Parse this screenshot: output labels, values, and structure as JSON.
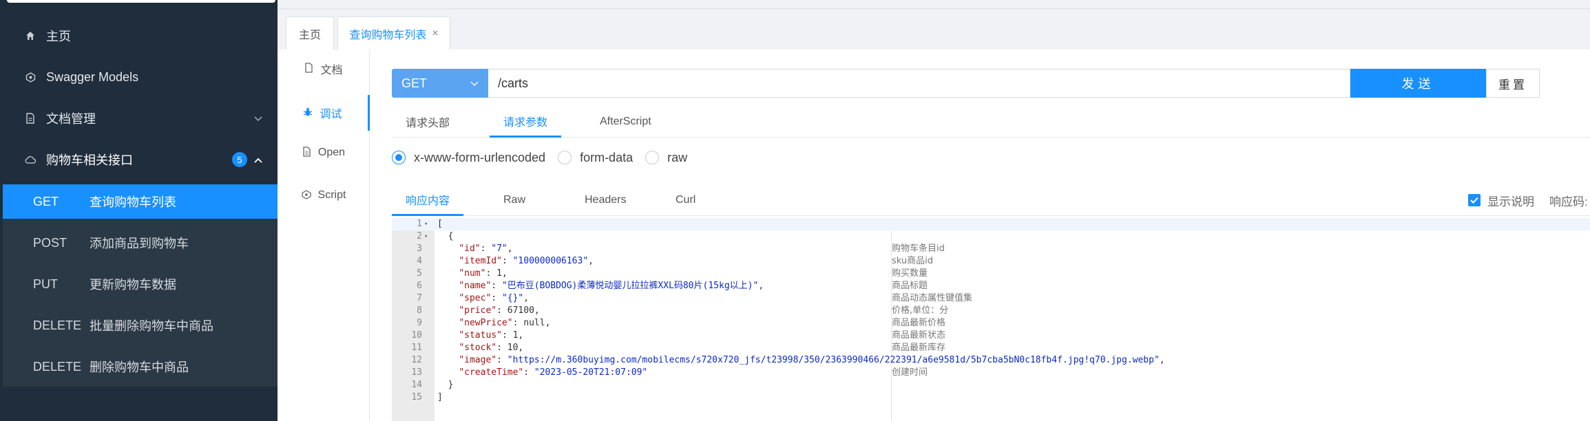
{
  "sidebar": {
    "items": [
      {
        "icon": "home-icon",
        "label": "主页"
      },
      {
        "icon": "swagger-models-icon",
        "label": "Swagger Models"
      },
      {
        "icon": "document-icon",
        "label": "文档管理"
      },
      {
        "icon": "cloud-icon",
        "label": "购物车相关接口",
        "badge": "5"
      }
    ],
    "sub_items": [
      {
        "method": "GET",
        "label": "查询购物车列表"
      },
      {
        "method": "POST",
        "label": "添加商品到购物车"
      },
      {
        "method": "PUT",
        "label": "更新购物车数据"
      },
      {
        "method": "DELETE",
        "label": "批量删除购物车中商品"
      },
      {
        "method": "DELETE",
        "label": "删除购物车中商品"
      }
    ]
  },
  "tabs": [
    {
      "label": "主页"
    },
    {
      "label": "查询购物车列表",
      "close": "×"
    }
  ],
  "subnav": [
    {
      "label": "文档"
    },
    {
      "label": "调试"
    },
    {
      "label": "Open"
    },
    {
      "label": "Script"
    }
  ],
  "request": {
    "method": "GET",
    "url": "/carts",
    "send_label": "发送",
    "reset_label": "重置"
  },
  "param_tabs": [
    "请求头部",
    "请求参数",
    "AfterScript"
  ],
  "body_types": [
    "x-www-form-urlencoded",
    "form-data",
    "raw"
  ],
  "response_tabs": [
    "响应内容",
    "Raw",
    "Headers",
    "Curl"
  ],
  "response_options": {
    "show_desc_label": "显示说明",
    "status_label": "响应码:"
  },
  "code_lines": [
    {
      "n": "1",
      "fold": "▾",
      "text": "["
    },
    {
      "n": "2",
      "fold": "▾",
      "text": "  {"
    },
    {
      "n": "3",
      "key": "\"id\"",
      "val": "\"7\"",
      "comment": "购物车条目id"
    },
    {
      "n": "4",
      "key": "\"itemId\"",
      "val": "\"100000006163\"",
      "comment": "sku商品id"
    },
    {
      "n": "5",
      "key": "\"num\"",
      "val": "1",
      "comment": "购买数量"
    },
    {
      "n": "6",
      "key": "\"name\"",
      "val": "\"巴布豆(BOBDOG)柔薄悦动婴儿拉拉裤XXL码80片(15kg以上)\"",
      "comment": "商品标题"
    },
    {
      "n": "7",
      "key": "\"spec\"",
      "val": "\"{}\"",
      "comment": "商品动态属性键值集"
    },
    {
      "n": "8",
      "key": "\"price\"",
      "val": "67100",
      "comment": "价格,单位：分"
    },
    {
      "n": "9",
      "key": "\"newPrice\"",
      "val": "null",
      "comment": "商品最新价格"
    },
    {
      "n": "10",
      "key": "\"status\"",
      "val": "1",
      "comment": "商品最新状态"
    },
    {
      "n": "11",
      "key": "\"stock\"",
      "val": "10",
      "comment": "商品最新库存"
    },
    {
      "n": "12",
      "key": "\"image\"",
      "val": "\"https://m.360buyimg.com/mobilecms/s720x720_jfs/t23998/350/2363990466/222391/a6e9581d/5b7cba5bN0c18fb4f.jpg!q70.jpg.webp\"",
      "comment": ""
    },
    {
      "n": "13",
      "key": "\"createTime\"",
      "val": "\"2023-05-20T21:07:09\"",
      "comment": "创建时间"
    },
    {
      "n": "14",
      "text": "  }"
    },
    {
      "n": "15",
      "text": "]"
    }
  ]
}
